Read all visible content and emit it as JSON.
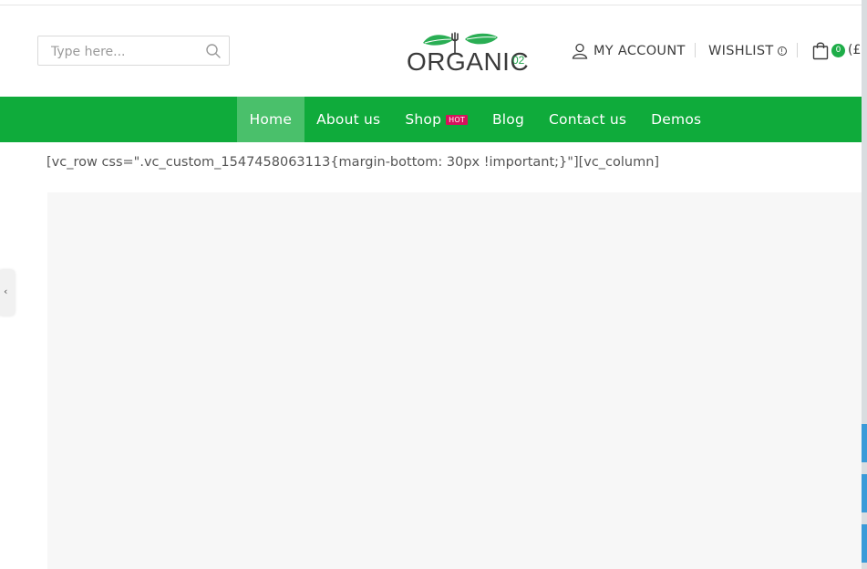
{
  "search": {
    "placeholder": "Type here...",
    "value": "",
    "icon": "search-icon"
  },
  "logo": {
    "word": "ORGANIC",
    "suffix": "02",
    "icon": "leaves-fork-logo"
  },
  "header": {
    "account_label": "MY ACCOUNT",
    "account_icon": "user-icon",
    "wishlist_label": "WISHLIST",
    "wishlist_icon": "info-icon",
    "cart_icon": "shopping-bag-icon",
    "cart_count": "0",
    "cart_total": "(£"
  },
  "nav": {
    "items": [
      {
        "label": "Home",
        "active": true
      },
      {
        "label": "About us"
      },
      {
        "label": "Shop",
        "badge": "HOT"
      },
      {
        "label": "Blog"
      },
      {
        "label": "Contact us"
      },
      {
        "label": "Demos"
      }
    ]
  },
  "content": {
    "shortcode": "[vc_row css=\".vc_custom_1547458063113{margin-bottom: 30px !important;}\"][vc_column]"
  },
  "side_tab": {
    "icon": "chevron-left-icon",
    "glyph": "‹"
  },
  "colors": {
    "brand_green": "#0fab3b",
    "active_green": "#4ac06b",
    "hot_badge": "#d6125c",
    "panel_bg": "#f7f7f7"
  }
}
